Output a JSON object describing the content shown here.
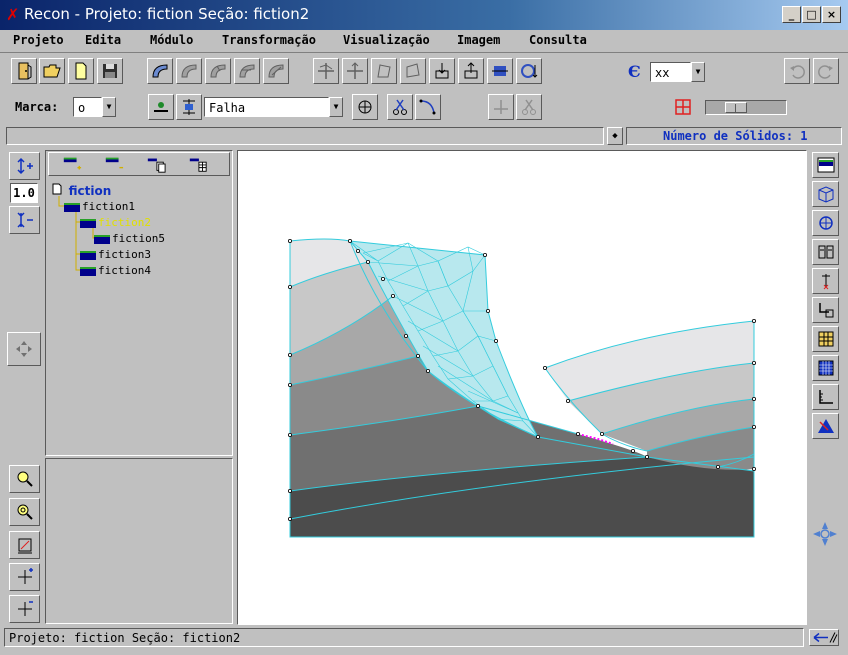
{
  "window": {
    "title": "Recon - Projeto: fiction  Seção: fiction2",
    "minimize_glyph": "_",
    "maximize_glyph": "□",
    "close_glyph": "×"
  },
  "menu": [
    "Projeto",
    "Edita",
    "Módulo",
    "Transformação",
    "Visualização",
    "Imagem",
    "Consulta"
  ],
  "toolbar": {
    "coord_combo_value": "xx",
    "accent_color": "#0000ff"
  },
  "toolbar2": {
    "marca_label": "Marca:",
    "marca_value": "o",
    "falha_value": "Falha"
  },
  "info": {
    "solids_label": "Número de Sólidos: 1"
  },
  "left_panel": {
    "scale_value": "1.0"
  },
  "tree": {
    "root": "fiction",
    "items": [
      {
        "label": "fiction1",
        "selected": false
      },
      {
        "label": "fiction2",
        "selected": true
      },
      {
        "label": "fiction5",
        "selected": false
      },
      {
        "label": "fiction3",
        "selected": false
      },
      {
        "label": "fiction4",
        "selected": false
      }
    ]
  },
  "status": {
    "text": "Projeto: fiction   Seção: fiction2"
  },
  "colors": {
    "layer_lightest": "#e6e6e8",
    "layer_light": "#c8c8c8",
    "layer_mid": "#a8a8a8",
    "layer_dark": "#8a8a8a",
    "layer_darker": "#707070",
    "layer_darkest": "#4c4c4c",
    "mesh": "#33ccdd",
    "fault": "#ff00ff"
  }
}
